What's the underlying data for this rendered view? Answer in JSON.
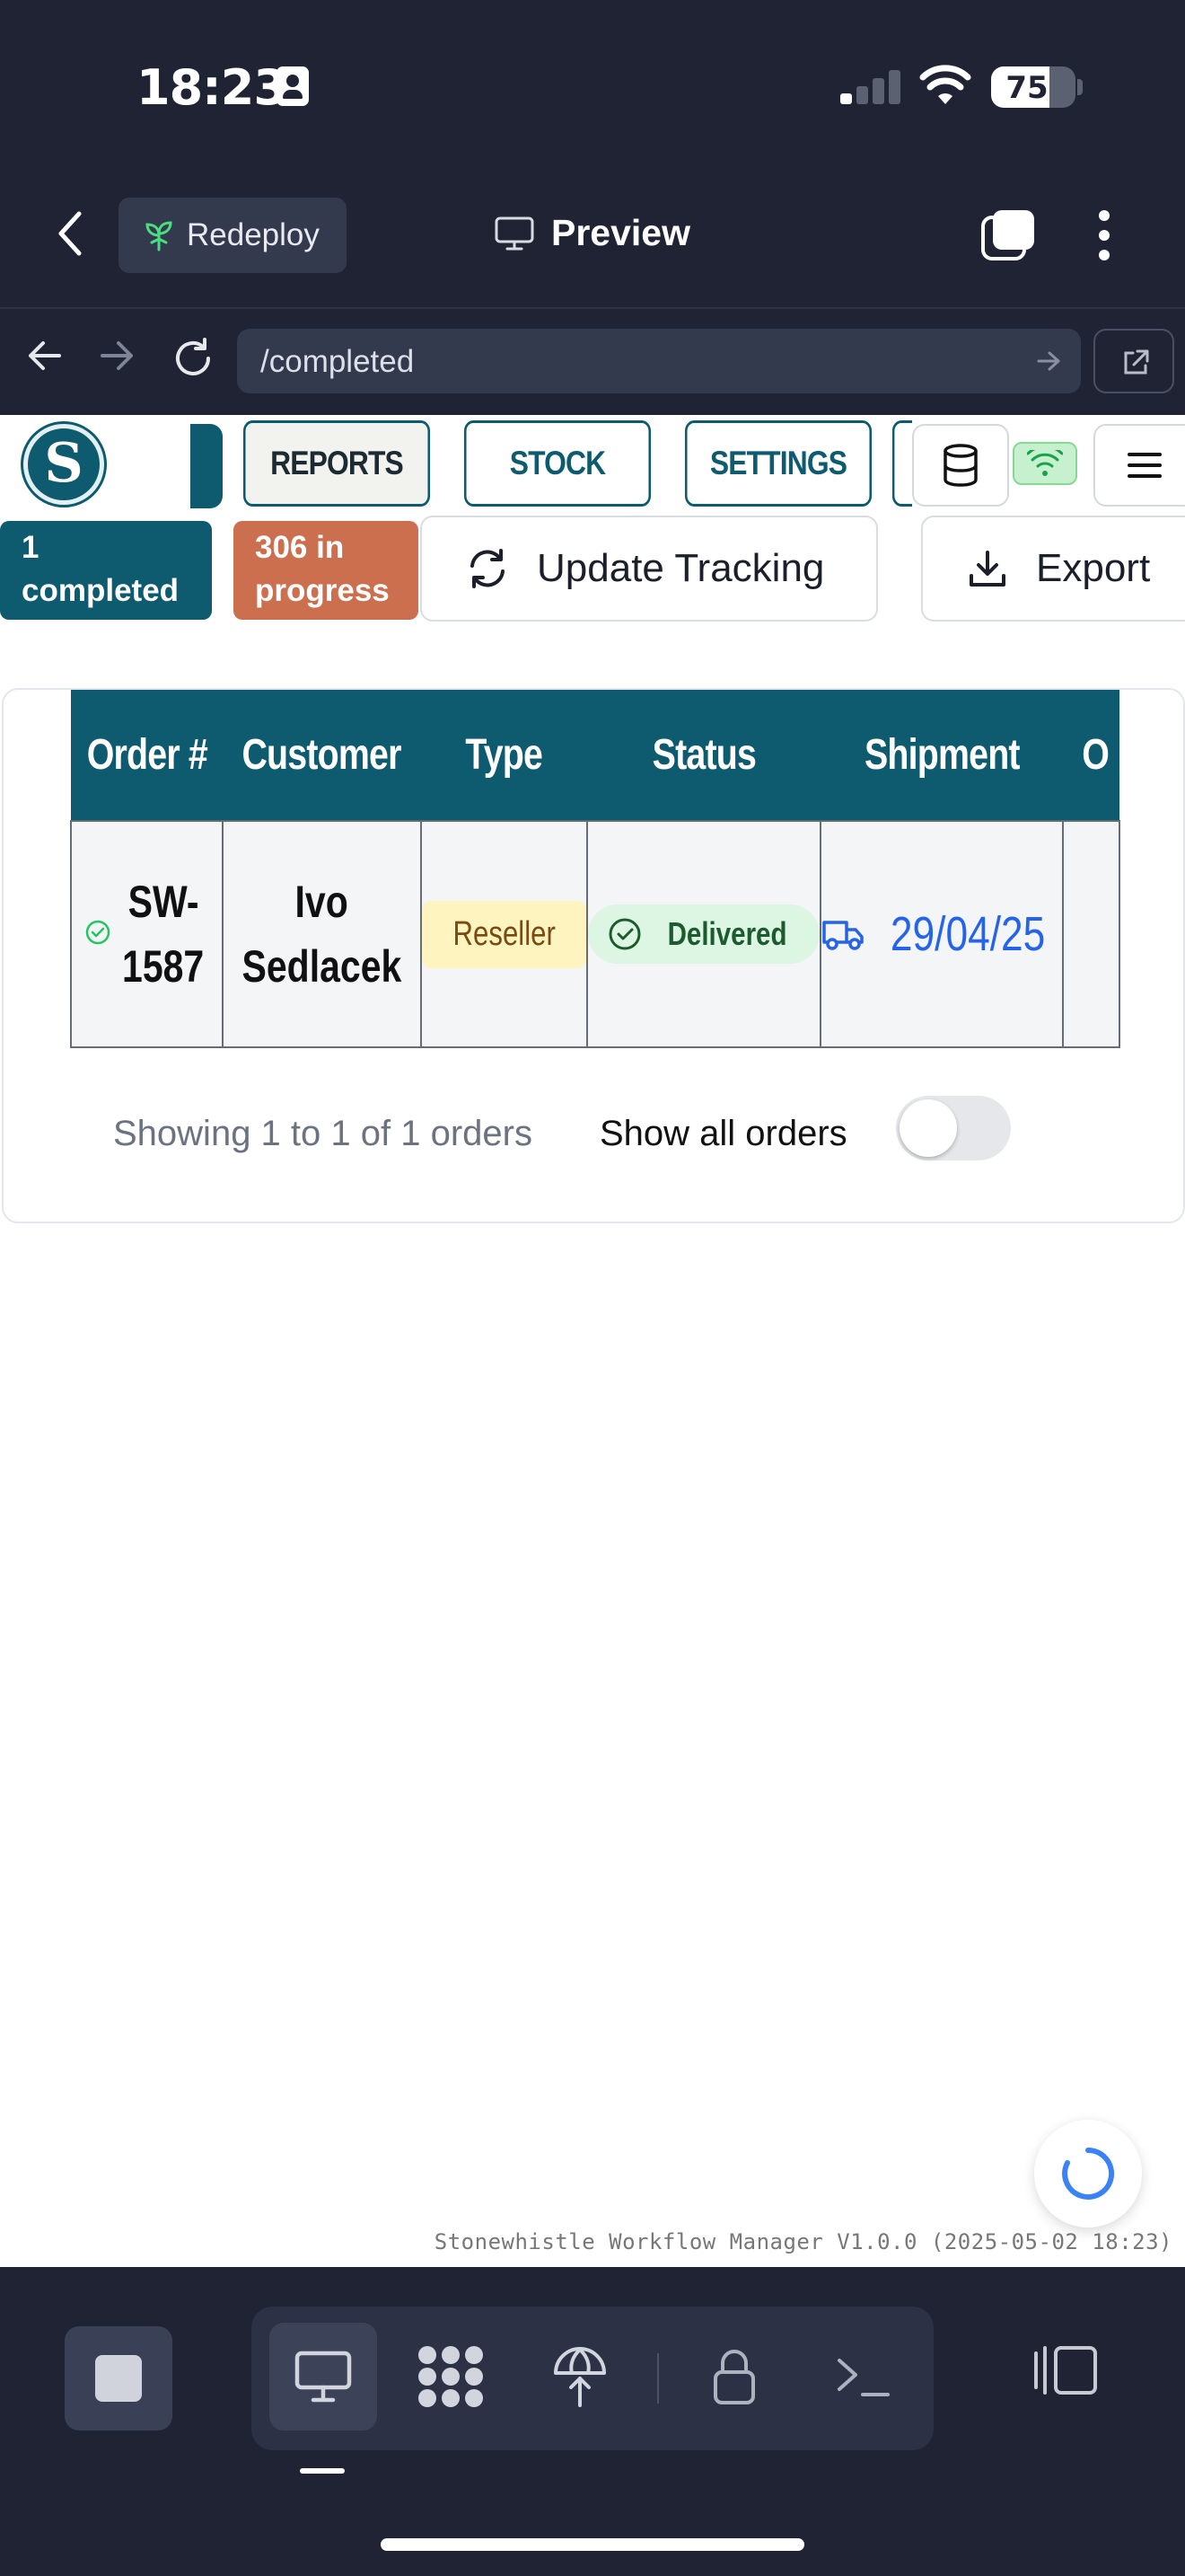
{
  "status_bar": {
    "time": "18:23",
    "battery": "75",
    "battery_level": 0.75,
    "signal_bars": 1,
    "icons": [
      "contact-card-icon",
      "cellular-signal-icon",
      "wifi-icon",
      "battery-icon"
    ]
  },
  "editor_header": {
    "redeploy_label": "Redeploy",
    "preview_label": "Preview",
    "icons": [
      "chevron-left-icon",
      "sprout-icon",
      "monitor-icon",
      "tabs-icon",
      "more-vertical-icon"
    ]
  },
  "browser_nav": {
    "url": "/completed",
    "icons": [
      "arrow-left-icon",
      "arrow-right-icon",
      "reload-icon",
      "arrow-go-icon",
      "external-link-icon"
    ]
  },
  "app_nav": {
    "logo_letter": "S",
    "tabs": [
      {
        "label": "REPORTS"
      },
      {
        "label": "STOCK"
      },
      {
        "label": "SETTINGS"
      }
    ],
    "icons": [
      "database-icon",
      "wifi-connected-icon",
      "menu-icon"
    ],
    "colors": {
      "brand_teal": "#0e5a6e",
      "connected_green": "#86d897"
    }
  },
  "toolbar": {
    "completed_count": "1",
    "completed_label": "completed",
    "in_progress_count": "306 in",
    "in_progress_label": "progress",
    "update_tracking_label": "Update Tracking",
    "export_label": "Export",
    "colors": {
      "completed_bg": "#0e5a6e",
      "in_progress_bg": "#cc6f4f"
    }
  },
  "orders_table": {
    "columns": [
      "Order #",
      "Customer",
      "Type",
      "Status",
      "Shipment",
      "O"
    ],
    "rows": [
      {
        "order_line1": "SW-",
        "order_line2": "1587",
        "customer_line1": "Ivo",
        "customer_line2": "Sedlacek",
        "type": "Reseller",
        "status": "Delivered",
        "shipment": "29/04/25"
      }
    ],
    "showing_text": "Showing 1 to 1 of 1 orders",
    "show_all_label": "Show all orders",
    "show_all_enabled": false
  },
  "footer": {
    "version_text": "Stonewhistle Workflow Manager V1.0.0 (2025-05-02 18:23)"
  },
  "bottom_toolbar": {
    "active_mode": "desktop-preview",
    "icons": [
      "stop-icon",
      "desktop-icon",
      "apps-grid-icon",
      "deploy-icon",
      "lock-icon",
      "terminal-icon",
      "panel-toggle-icon"
    ]
  }
}
